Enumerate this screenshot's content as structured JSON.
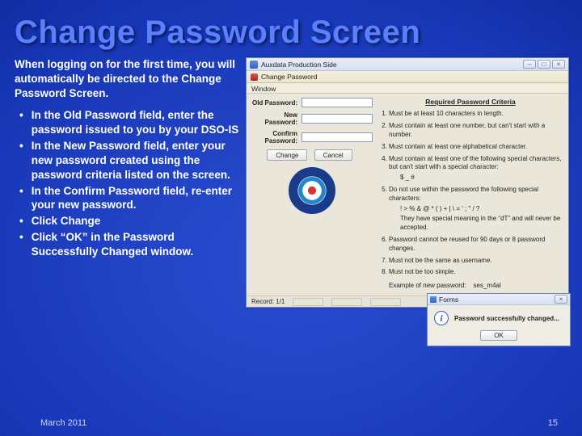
{
  "title": "Change Password Screen",
  "intro": "When logging on for the first time, you will automatically be directed to the Change Password Screen.",
  "bullets": [
    "In the Old Password field, enter the password issued to you by your DSO-IS",
    "In the New Password field, enter your new password created using the password criteria listed on the screen.",
    "In the Confirm Password field, re-enter your new password.",
    "Click Change",
    "Click “OK” in the Password Successfully Changed window."
  ],
  "app": {
    "titlebar": "Auxdata Production Side",
    "subbar": "Change Password",
    "menubar": "Window",
    "form": {
      "old_label": "Old Password:",
      "new_label": "New Password:",
      "confirm_label": "Confirm Password:",
      "change_btn": "Change",
      "cancel_btn": "Cancel"
    },
    "criteria": {
      "heading": "Required Password Criteria",
      "items": [
        "Must be at least 10 characters in length.",
        "Must contain at least one number, but can't start with a number.",
        "Must contain at least one alphabetical character.",
        "Must contain at least one of the following special characters, but can't start with a special character:",
        "Do not use within the password the following special characters:",
        "They have special meaning in the “dT” and will never be accepted.",
        "Password cannot be reused for 90 days or 8 password changes.",
        "Must not be the same as username.",
        "Must not be too simple."
      ],
      "special_allowed": "$ _ #",
      "special_denied": "! > % & @ * ( ) + | \\ = ' ; \" / ?",
      "example_label": "Example of new password:",
      "example_value": "ses_m4al"
    },
    "status": "Record: 1/1"
  },
  "dialog": {
    "title": "Forms",
    "message": "Password successfully changed...",
    "ok": "OK"
  },
  "footer": {
    "left": "March 2011",
    "right": "15"
  }
}
